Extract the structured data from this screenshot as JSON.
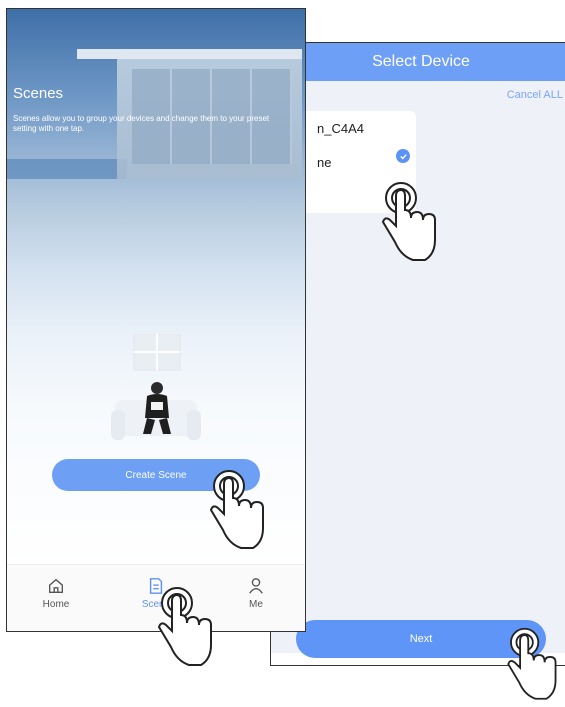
{
  "left_screen": {
    "title": "Scenes",
    "description": "Scenes allow you to group your devices and change them to your preset setting with one tap.",
    "create_button_label": "Create Scene",
    "tabs": [
      {
        "label": "Home",
        "icon": "home-icon",
        "active": false
      },
      {
        "label": "Scene",
        "icon": "scene-icon",
        "active": true
      },
      {
        "label": "Me",
        "icon": "person-icon",
        "active": false
      }
    ]
  },
  "right_screen": {
    "header_title": "Select Device",
    "cancel_all_label": "Cancel ALL",
    "device": {
      "name": "n_C4A4",
      "subtitle": "ne",
      "selected": true
    },
    "next_button_label": "Next"
  },
  "colors": {
    "accent": "#6e9ff7",
    "button": "#5e95f7",
    "check": "#5d93f5"
  },
  "annotation_icons": [
    "tap-hand-icon"
  ]
}
